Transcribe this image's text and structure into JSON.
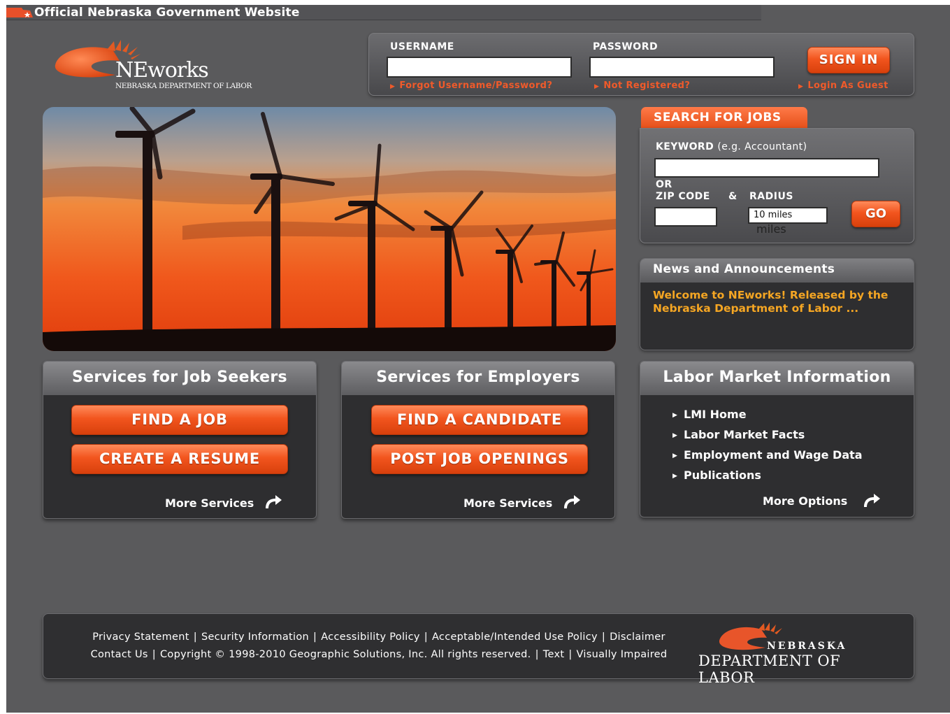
{
  "banner": {
    "title": "Official Nebraska Government Website"
  },
  "logo": {
    "name": "NEworks",
    "subtitle": "NEBRASKA DEPARTMENT OF LABOR"
  },
  "login": {
    "username_label": "USERNAME",
    "password_label": "PASSWORD",
    "username_value": "",
    "password_value": "",
    "sign_in": "SIGN IN",
    "forgot": "Forgot Username/Password?",
    "not_registered": "Not Registered?",
    "guest": "Login As Guest"
  },
  "search": {
    "tab": "SEARCH FOR JOBS",
    "keyword_label": "KEYWORD",
    "keyword_hint": "(e.g. Accountant)",
    "keyword_value": "",
    "or": "OR",
    "zip_label": "ZIP CODE",
    "amp": "&",
    "radius_label": "RADIUS",
    "zip_value": "",
    "radius_value": "10 miles",
    "radius_ghost": "miles",
    "go": "GO"
  },
  "news": {
    "title": "News and Announcements",
    "body": "Welcome to NEworks! Released by the Nebraska Department of Labor ..."
  },
  "job_seekers": {
    "title": "Services for Job Seekers",
    "btn1": "FIND A JOB",
    "btn2": "CREATE A RESUME",
    "more": "More Services"
  },
  "employers": {
    "title": "Services for Employers",
    "btn1": "FIND A CANDIDATE",
    "btn2": "POST JOB OPENINGS",
    "more": "More Services"
  },
  "lmi": {
    "title": "Labor Market Information",
    "items": [
      "LMI Home",
      "Labor Market Facts",
      "Employment and Wage Data",
      "Publications"
    ],
    "more": "More Options"
  },
  "footer": {
    "privacy": "Privacy Statement",
    "security": "Security Information",
    "accessibility": "Accessibility Policy",
    "acceptable": "Acceptable/Intended Use Policy",
    "disclaimer": "Disclaimer",
    "contact": "Contact Us",
    "copyright": "Copyright © 1998-2010 Geographic Solutions, Inc. All rights reserved.",
    "text": "Text",
    "visually": "Visually Impaired",
    "sep": "|",
    "dol_state": "NEBRASKA",
    "dol_dept": "DEPARTMENT OF LABOR"
  },
  "colors": {
    "accent": "#f05a2a",
    "news_text": "#f5a623",
    "background": "#5a5a5c",
    "panel_dark": "#2e2e30"
  }
}
